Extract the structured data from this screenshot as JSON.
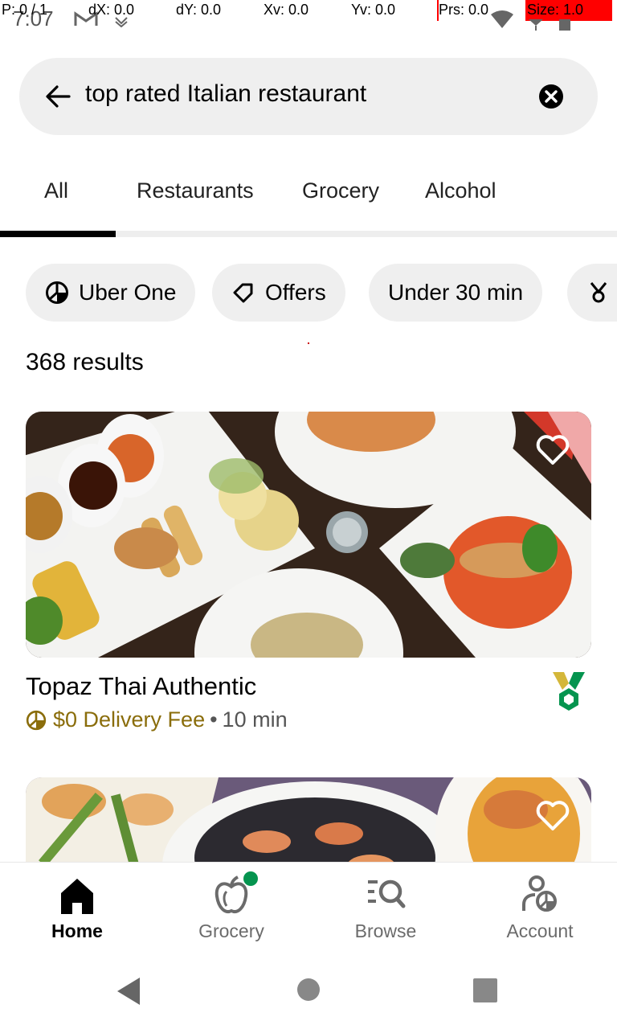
{
  "status_bar": {
    "clock": "7:07",
    "debug": {
      "pointer": "P: 0 / 1",
      "dx": "dX: 0.0",
      "dy": "dY: 0.0",
      "xv": "Xv: 0.0",
      "yv": "Yv: 0.0",
      "prs": "Prs: 0.0",
      "size": "Size: 1.0"
    }
  },
  "search": {
    "query": "top rated Italian restaurant",
    "back_icon": "arrow-left-icon",
    "clear_icon": "clear-circle-icon"
  },
  "tabs": [
    {
      "label": "All",
      "active": true
    },
    {
      "label": "Restaurants",
      "active": false
    },
    {
      "label": "Grocery",
      "active": false
    },
    {
      "label": "Alcohol",
      "active": false
    }
  ],
  "chips": [
    {
      "label": "Uber One",
      "icon": "uber-one-icon"
    },
    {
      "label": "Offers",
      "icon": "tag-icon"
    },
    {
      "label": "Under 30 min",
      "icon": ""
    },
    {
      "label": "",
      "icon": "ribbon-icon"
    }
  ],
  "results_count": "368 results",
  "stores": [
    {
      "name": "Topaz Thai Authentic",
      "delivery_fee": "$0 Delivery Fee",
      "separator": "•",
      "time": "10 min",
      "favorite_icon": "heart-outline-icon",
      "badge_icon": "top-rated-medal-icon"
    },
    {
      "favorite_icon": "heart-outline-icon"
    }
  ],
  "bottom_nav": [
    {
      "label": "Home",
      "icon": "home-icon",
      "active": true
    },
    {
      "label": "Grocery",
      "icon": "apple-icon",
      "active": false
    },
    {
      "label": "Browse",
      "icon": "browse-search-icon",
      "active": false
    },
    {
      "label": "Account",
      "icon": "account-icon",
      "active": false
    }
  ],
  "colors": {
    "accent_gold": "#8a6d0b",
    "badge_green": "#05944f",
    "notification_dot": "#05944f"
  }
}
